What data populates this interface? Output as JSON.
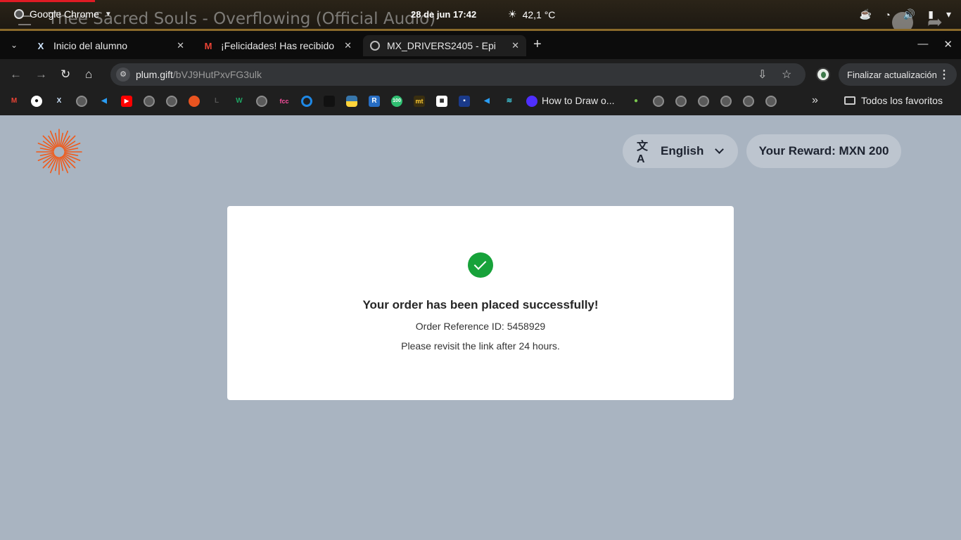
{
  "system_bar": {
    "app_name": "Google Chrome",
    "media_title": "Thee Sacred Souls - Overflowing (Official Audio)",
    "datetime": "28 de jun  17:42",
    "weather": "42,1 °C"
  },
  "tabs": [
    {
      "label": "Inicio del alumno",
      "favicon": "x-icon"
    },
    {
      "label": "¡Felicidades! Has recibido",
      "favicon": "gmail-icon"
    },
    {
      "label": "MX_DRIVERS2405 - Epi",
      "favicon": "globe-icon"
    }
  ],
  "toolbar": {
    "url_host": "plum.gift",
    "url_path": "/bVJ9HutPxvFG3ulk",
    "update_label": "Finalizar actualización"
  },
  "bookmarks": {
    "visible_label": "How to Draw o...",
    "folder_label": "Todos los favoritos"
  },
  "page": {
    "language_label": "English",
    "reward_label": "Your Reward: MXN 200",
    "success_title": "Your order has been placed successfully!",
    "order_reference": "Order Reference ID: 5458929",
    "revisit_note": "Please revisit the link after 24 hours."
  },
  "colors": {
    "page_background": "#a9b4c1",
    "success_green": "#17a23a",
    "logo_orange": "#f05a1a"
  }
}
